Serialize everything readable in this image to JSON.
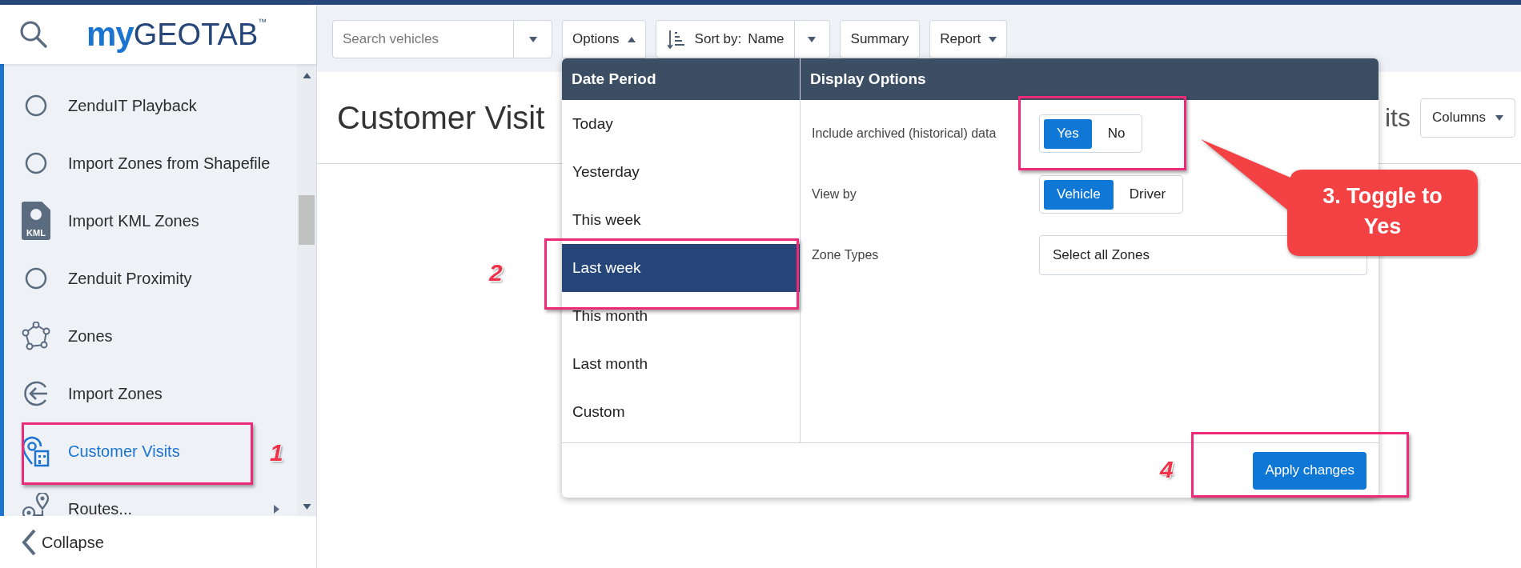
{
  "logo": {
    "first": "my",
    "second": "GEOTAB",
    "mark": "™"
  },
  "sidebar": {
    "items": [
      {
        "label": "ZenduIT Playback",
        "kind": "plain",
        "selected": false
      },
      {
        "label": "Import Zones from Shapefile",
        "kind": "plain",
        "selected": false
      },
      {
        "label": "Import KML Zones",
        "kind": "kml",
        "badge": "KML",
        "selected": false
      },
      {
        "label": "Zenduit Proximity",
        "kind": "plain",
        "selected": false
      },
      {
        "label": "Zones",
        "kind": "zones",
        "selected": false
      },
      {
        "label": "Import Zones",
        "kind": "import",
        "selected": false
      },
      {
        "label": "Customer Visits",
        "kind": "visits",
        "selected": true
      },
      {
        "label": "Routes...",
        "kind": "routes",
        "selected": false
      }
    ],
    "collapse": "Collapse"
  },
  "toolbar": {
    "search": {
      "placeholder": "Search vehicles"
    },
    "options": {
      "label": "Options",
      "expanded": true
    },
    "sort": {
      "label": "Sort by:",
      "value": "Name"
    },
    "summary": "Summary",
    "report": "Report"
  },
  "page": {
    "title": "Customer Visit",
    "title_fragment": "its",
    "columns": "Columns"
  },
  "dropdown": {
    "date_period": {
      "title": "Date Period",
      "items": [
        {
          "label": "Today",
          "selected": false
        },
        {
          "label": "Yesterday",
          "selected": false
        },
        {
          "label": "This week",
          "selected": false
        },
        {
          "label": "Last week",
          "selected": true
        },
        {
          "label": "This month",
          "selected": false
        },
        {
          "label": "Last month",
          "selected": false
        },
        {
          "label": "Custom",
          "selected": false
        }
      ]
    },
    "display_options": {
      "title": "Display Options",
      "rows": [
        {
          "kind": "toggle",
          "label": "Include archived (historical) data",
          "options": [
            {
              "label": "Yes",
              "selected": true
            },
            {
              "label": "No",
              "selected": false
            }
          ]
        },
        {
          "kind": "toggle",
          "label": "View by",
          "options": [
            {
              "label": "Vehicle",
              "selected": true
            },
            {
              "label": "Driver",
              "selected": false
            }
          ]
        },
        {
          "kind": "select",
          "label": "Zone Types",
          "value": "Select all Zones"
        }
      ]
    },
    "apply": "Apply changes"
  },
  "annotations": {
    "markers": [
      "1",
      "2",
      "4"
    ],
    "callout": "3. Toggle to Yes"
  }
}
